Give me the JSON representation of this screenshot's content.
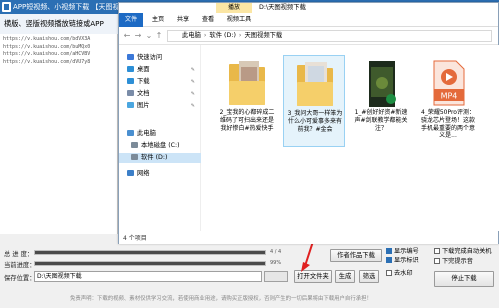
{
  "app": {
    "title": "APP短视频、小视频下载 【天图视频助手】",
    "description": "横版、竖版视频播放链接或APP",
    "url_lines": [
      "https://v.kuaishou.com/bdVX3A",
      "https://v.kuaishou.com/buMQx0",
      "https://v.kuaishou.com/aHCVBV",
      "https://v.kuaishou.com/dVU7y8"
    ],
    "total_progress_label": "总 进 度：",
    "total_progress": 1.0,
    "total_progress_text": "4 / 4",
    "current_progress_label": "当前进度：",
    "current_progress": 1.0,
    "current_progress_text": "99%",
    "save_label": "保存位置：",
    "save_path": "D:\\天图视频下载",
    "buttons": {
      "author_download": "作者作品下载",
      "open_folder": "打开文件夹",
      "generate": "生成",
      "select": "筛选",
      "stop_download": "停止下载"
    },
    "checkboxes": {
      "show_number": "显示编号",
      "show_tag": "显示标识",
      "auto_close": "下载完成自动关机",
      "finish_prompt": "下完提示音",
      "watermark": "去水印"
    },
    "disclaimer": "免责声明：下载的视频、素材仅供学习交流，若使用商业用途，请购买正版授权，否则产生的一切后果将由下载用户自行承担！"
  },
  "explorer": {
    "context_tab": "播放",
    "title": "D:\\天图视频下载",
    "tabs": [
      "文件",
      "主页",
      "共享",
      "查看",
      "视频工具"
    ],
    "breadcrumb": [
      "此电脑",
      "软件 (D:)",
      "天图视频下载"
    ],
    "nav": [
      {
        "label": "快速访问",
        "icon": "star-icon",
        "color": "#3b78d8",
        "pin": false
      },
      {
        "label": "桌面",
        "icon": "desktop-icon",
        "color": "#2d8fd6",
        "pin": true
      },
      {
        "label": "下载",
        "icon": "download-icon",
        "color": "#2d8fd6",
        "pin": true
      },
      {
        "label": "文档",
        "icon": "document-icon",
        "color": "#7a8ca8",
        "pin": true
      },
      {
        "label": "图片",
        "icon": "picture-icon",
        "color": "#4aa6e0",
        "pin": true
      },
      {
        "label": "此电脑",
        "icon": "computer-icon",
        "color": "#4a8fd0",
        "pin": false
      },
      {
        "label": "本地磁盘 (C:)",
        "icon": "drive-icon",
        "color": "#7c8b99",
        "pin": false
      },
      {
        "label": "软件 (D:)",
        "icon": "drive-icon",
        "color": "#7c8b99",
        "pin": false
      },
      {
        "label": "网络",
        "icon": "network-icon",
        "color": "#3c7fc8",
        "pin": false
      }
    ],
    "files": [
      {
        "name": "2_宝我的心都碎成二维码了可扫出来还是我好惨白#热爱快手",
        "thumb": "folder"
      },
      {
        "name": "3_我问大哥一样笨为什么小可爱事多来有前我？#金会",
        "thumb": "folder"
      },
      {
        "name": "1_#创好好资#新速声#剑联教学都能关注？",
        "thumb": "video"
      },
      {
        "name": "4_荣耀50Pro评测：骁龙芯片登场！这款手机最重要的两个意义是...",
        "thumb": "mp4"
      }
    ],
    "status": "4 个项目"
  }
}
